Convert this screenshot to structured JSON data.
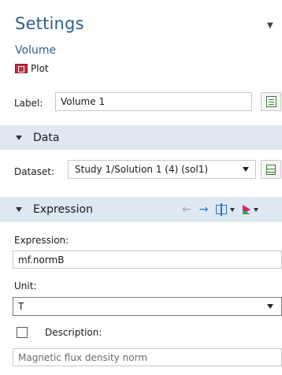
{
  "header": {
    "title": "Settings",
    "subtitle": "Volume",
    "node_label": "Plot"
  },
  "label_field": {
    "label": "Label:",
    "value": "Volume 1"
  },
  "sections": {
    "data": {
      "title": "Data"
    },
    "expression": {
      "title": "Expression"
    }
  },
  "dataset": {
    "label": "Dataset:",
    "selected": "Study 1/Solution 1 (4) (sol1)"
  },
  "expression": {
    "label": "Expression:",
    "value": "mf.normB"
  },
  "unit": {
    "label": "Unit:",
    "selected": "T"
  },
  "description": {
    "label": "Description:",
    "checked": false,
    "value": "Magnetic flux density norm"
  },
  "colors": {
    "title": "#2f5d8f",
    "section_bg": "#dfe8f2",
    "plot_icon": "#c7293f"
  }
}
